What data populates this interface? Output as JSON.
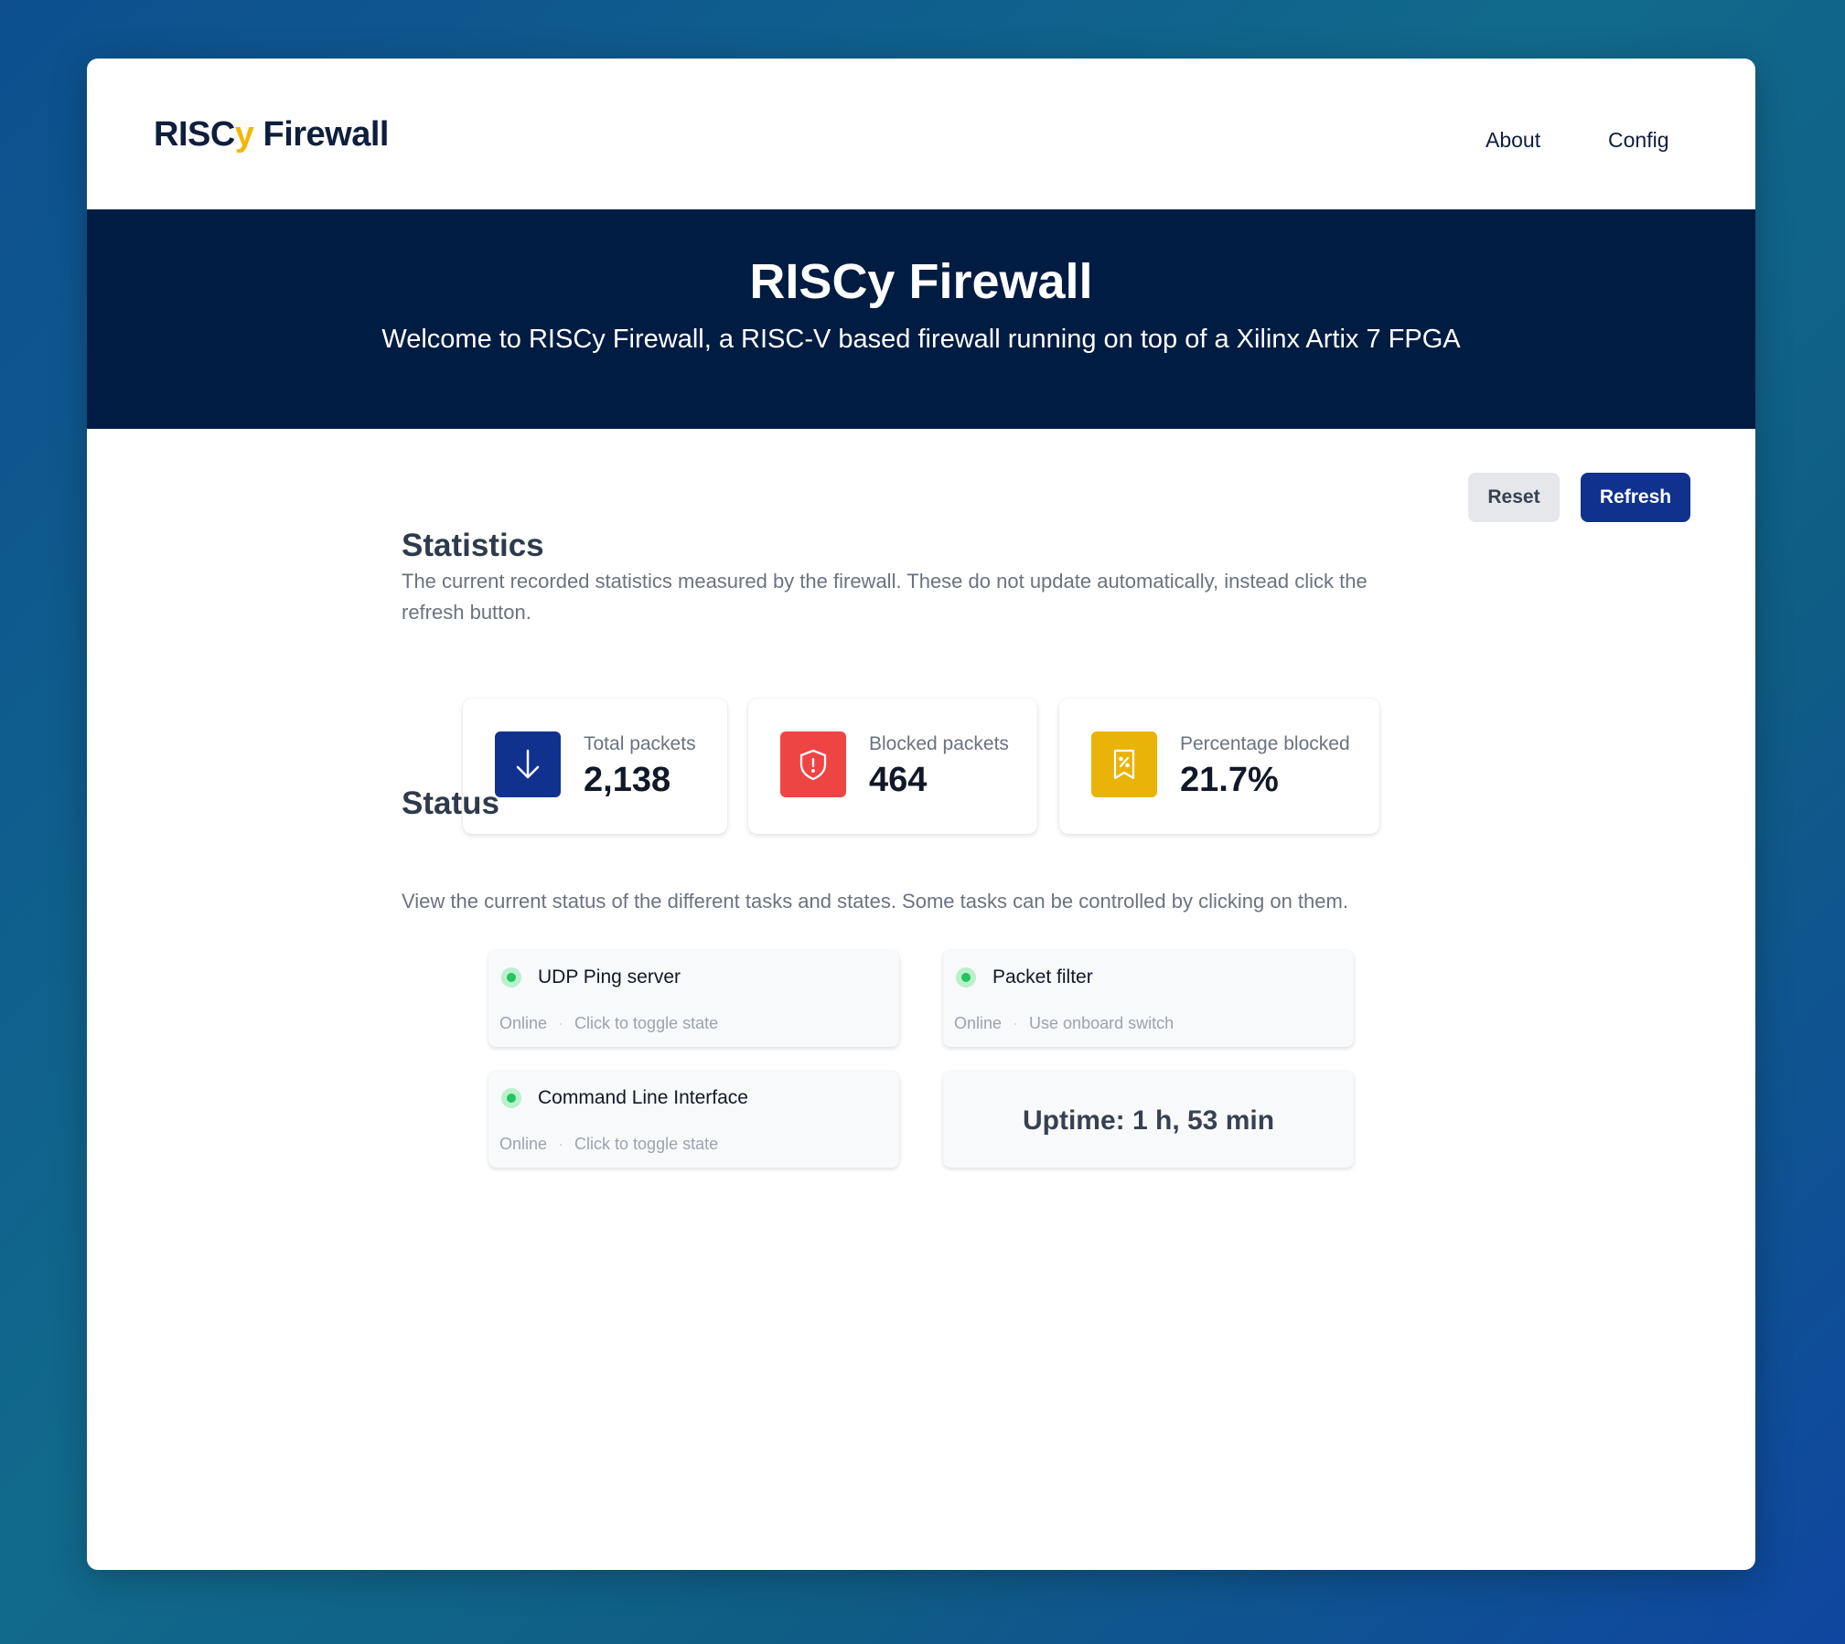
{
  "nav": {
    "logo_prefix": "RISC",
    "logo_accent": "y",
    "logo_suffix": " Firewall",
    "links": [
      "About",
      "Config"
    ]
  },
  "hero": {
    "title": "RISCy Firewall",
    "subtitle": "Welcome to RISCy Firewall, a RISC-V based firewall running on top of a Xilinx Artix 7 FPGA"
  },
  "actions": {
    "reset_label": "Reset",
    "refresh_label": "Refresh"
  },
  "statistics": {
    "title": "Statistics",
    "description": "The current recorded statistics measured by the firewall. These do not update automatically, instead click the refresh button.",
    "cards": [
      {
        "label": "Total packets",
        "value": "2,138",
        "icon": "arrow-down-icon",
        "color": "#10328e"
      },
      {
        "label": "Blocked packets",
        "value": "464",
        "icon": "shield-alert-icon",
        "color": "#ef4444"
      },
      {
        "label": "Percentage blocked",
        "value": "21.7%",
        "icon": "receipt-percent-icon",
        "color": "#eab308"
      }
    ]
  },
  "status": {
    "title": "Status",
    "description": "View the current status of the different tasks and states. Some tasks can be controlled by clicking on them.",
    "tasks": [
      {
        "name": "UDP Ping server",
        "state": "Online",
        "hint": "Click to toggle state"
      },
      {
        "name": "Packet filter",
        "state": "Online",
        "hint": "Use onboard switch"
      },
      {
        "name": "Command Line Interface",
        "state": "Online",
        "hint": "Click to toggle state"
      }
    ],
    "uptime": "Uptime: 1 h, 53 min"
  },
  "colors": {
    "brand_accent": "#f2b705",
    "hero_bg": "#001c42",
    "primary": "#10328e",
    "online": "#22c55e"
  }
}
